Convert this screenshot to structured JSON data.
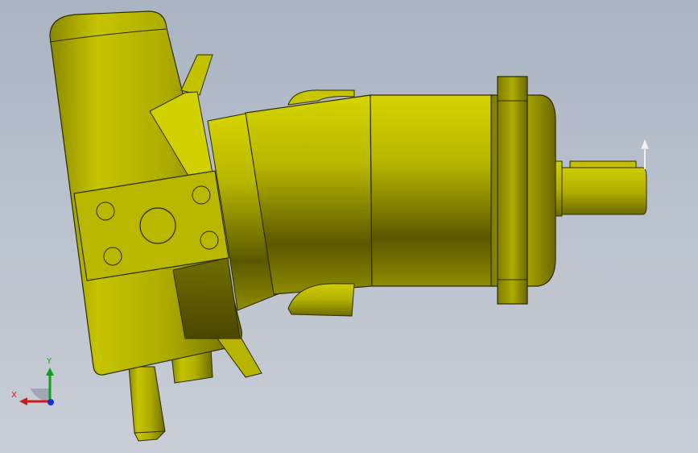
{
  "app": {
    "viewport": "3d-graphics-area"
  },
  "model": {
    "part": "axial-piston-pump",
    "body_color": "#b9b800",
    "edge_color": "#2d2a00"
  },
  "triad": {
    "x_label": "X",
    "y_label": "Y",
    "x_color": "#d01818",
    "y_color": "#0ea01e",
    "z_color": "#1a2fd0"
  }
}
